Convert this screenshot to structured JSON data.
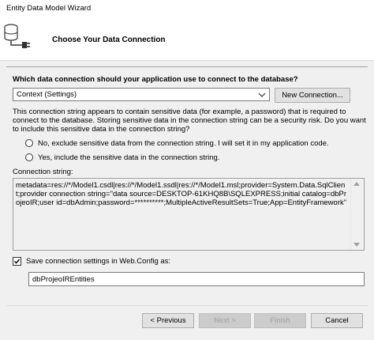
{
  "window": {
    "title": "Entity Data Model Wizard"
  },
  "header": {
    "title": "Choose Your Data Connection",
    "icon": "database-plug-icon"
  },
  "question": "Which data connection should your application use to connect to the database?",
  "connection_combo": {
    "selected": "Context (Settings)"
  },
  "new_connection_label": "New Connection...",
  "warning": "This connection string appears to contain sensitive data (for example, a password) that is required to connect to the database. Storing sensitive data in the connection string can be a security risk. Do you want to include this sensitive data in the connection string?",
  "options": {
    "exclude": "No, exclude sensitive data from the connection string. I will set it in my application code.",
    "include": "Yes, include the sensitive data in the connection string.",
    "selected": "none"
  },
  "connection_string": {
    "label": "Connection string:",
    "value": "metadata=res://*/Model1.csdl|res://*/Model1.ssdl|res://*/Model1.msl;provider=System.Data.SqlClient;provider connection string=\"data source=DESKTOP-61KHQ8B\\SQLEXPRESS;initial catalog=dbProjeoIR;user id=dbAdmin;password=**********;MultipleActiveResultSets=True;App=EntityFramework\""
  },
  "save_settings": {
    "checked": true,
    "label": "Save connection settings in Web.Config as:",
    "value": "dbProjeoIREntities"
  },
  "buttons": {
    "previous": "< Previous",
    "next": "Next >",
    "finish": "Finish",
    "cancel": "Cancel"
  }
}
